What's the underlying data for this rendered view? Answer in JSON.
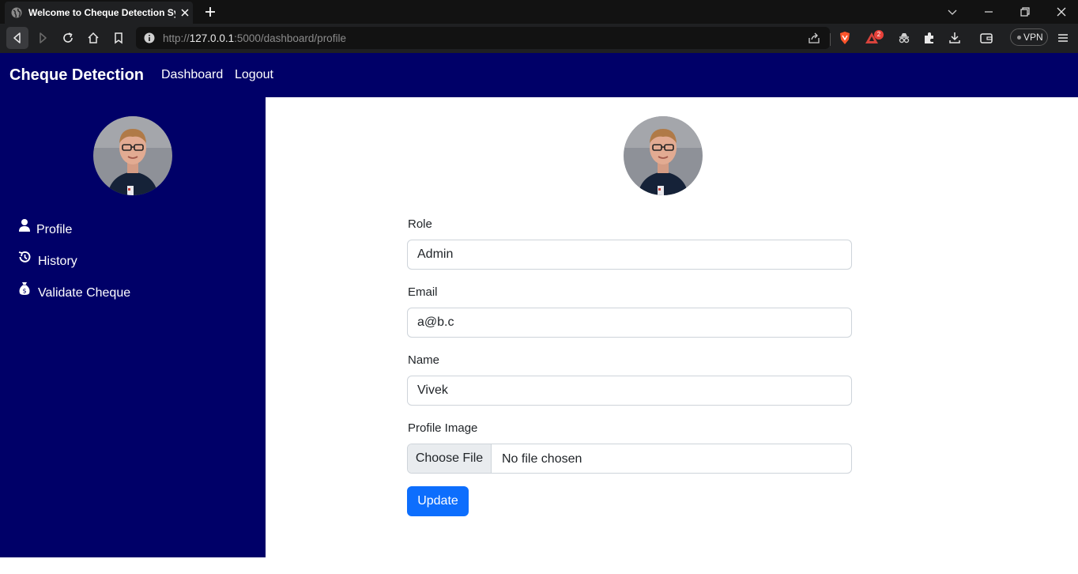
{
  "browser": {
    "tab_title": "Welcome to Cheque Detection Sy",
    "url_prefix": "http://",
    "url_host": "127.0.0.1",
    "url_rest": ":5000/dashboard/profile",
    "vpn_label": "VPN",
    "brave_rewards_count": "2"
  },
  "navbar": {
    "brand": "Cheque Detection",
    "links": [
      "Dashboard",
      "Logout"
    ]
  },
  "sidebar": {
    "items": [
      {
        "label": "Profile",
        "icon": "user-icon"
      },
      {
        "label": "History",
        "icon": "history-icon"
      },
      {
        "label": "Validate Cheque",
        "icon": "money-bag-icon"
      }
    ]
  },
  "form": {
    "role_label": "Role",
    "role_value": "Admin",
    "email_label": "Email",
    "email_value": "a@b.c",
    "name_label": "Name",
    "name_value": "Vivek",
    "image_label": "Profile Image",
    "choose_file_label": "Choose File",
    "file_status": "No file chosen",
    "update_label": "Update"
  },
  "colors": {
    "navbar_bg": "#000068",
    "primary_button": "#0d6efd"
  }
}
